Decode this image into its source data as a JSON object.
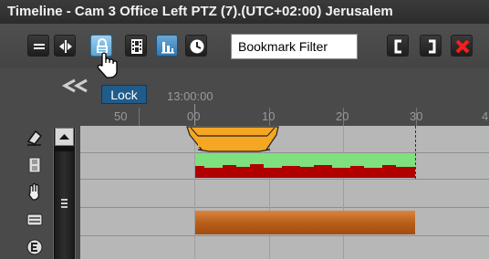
{
  "window": {
    "title": "Timeline - Cam 3 Office Left PTZ (7).(UTC+02:00) Jerusalem"
  },
  "toolbar": {
    "buttons": [
      {
        "name": "minimize-icon"
      },
      {
        "name": "expand-icon"
      },
      {
        "name": "lock-icon"
      },
      {
        "name": "film-icon"
      },
      {
        "name": "bar-chart-icon"
      },
      {
        "name": "clock-icon"
      }
    ],
    "bookmark_filter": "Bookmark Filter",
    "right_buttons": [
      {
        "name": "bracket-left-icon"
      },
      {
        "name": "bracket-right-icon"
      },
      {
        "name": "close-icon"
      }
    ]
  },
  "tooltip": {
    "text": "Lock"
  },
  "ruler": {
    "time": "13:00:00",
    "ticks": [
      "50",
      "00",
      "10",
      "20",
      "30",
      "4"
    ]
  },
  "sidebar": {
    "icons": [
      "eraser-icon",
      "film-strip-icon",
      "hand-icon",
      "keyboard-icon",
      "e-icon"
    ]
  },
  "colors": {
    "bookmark": "#f5a623",
    "motion_green": "#7fe07f",
    "motion_red": "#b00000",
    "recording": "#c8702a",
    "active_button": "#7bbbe3",
    "tooltip": "#1f5c8a"
  }
}
